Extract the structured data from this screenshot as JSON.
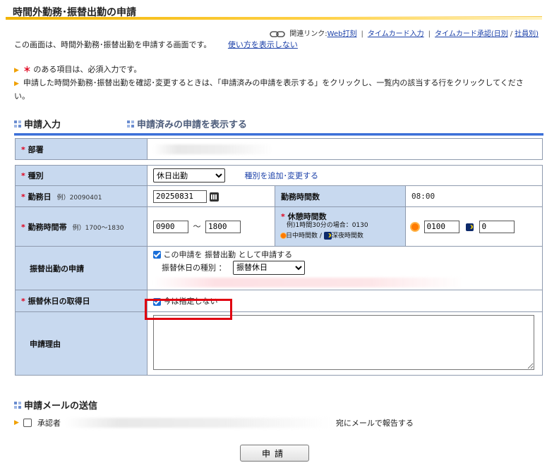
{
  "page": {
    "title": "時間外勤務･振替出勤の申請",
    "description": "この画面は、時間外勤務･振替出勤を申請する画面です。",
    "hide_help_link": "使い方を表示しない"
  },
  "related_links": {
    "label": "関連リンク:",
    "links": [
      "Web打刻",
      "タイムカード入力",
      "タイムカード承認(日別",
      "社員別)"
    ]
  },
  "notes": {
    "required_mark": "＊",
    "required_note": "のある項目は、必須入力です。",
    "confirm_note": "申請した時間外勤務･振替出勤を確認･変更するときは、「申請済みの申請を表示する」をクリックし、一覧内の該当する行をクリックしてください。"
  },
  "tabs": {
    "input": "申請入力",
    "submitted": "申請済みの申請を表示する"
  },
  "form": {
    "department": {
      "label": "部署",
      "value": ""
    },
    "type": {
      "label": "種別",
      "selected": "休日出勤",
      "add_link": "種別を追加･変更する"
    },
    "work_date": {
      "label": "勤務日",
      "example": "例）20090401",
      "value": "20250831"
    },
    "work_hours": {
      "label": "勤務時間数",
      "value": "08:00"
    },
    "work_time": {
      "label": "勤務時間帯",
      "example": "例）1700～1830",
      "start": "0900",
      "tilde": "～",
      "end": "1800"
    },
    "break_time": {
      "label": "休憩時間数",
      "example": "例)1時間30分の場合：0130",
      "day_label": "日中時間数",
      "night_label": "深夜時間数",
      "separator": "/",
      "day_value": "0100",
      "night_value": "0"
    },
    "substitute": {
      "label": "振替出勤の申請",
      "check_label": "この申請を 振替出勤 として申請する",
      "holiday_type_label": "振替休日の種別 ：",
      "holiday_type_selected": "振替休日"
    },
    "substitute_day": {
      "label": "振替休日の取得日",
      "check_label": "今は指定しない"
    },
    "reason": {
      "label": "申請理由",
      "value": ""
    }
  },
  "mail": {
    "title": "申請メールの送信",
    "approver_label": "承認者",
    "suffix": "宛にメールで報告する"
  },
  "submit_label": "申請",
  "colors": {
    "label_bg": "#c8d9ef",
    "accent": "#3a6fd8",
    "highlight": "#e00010"
  }
}
